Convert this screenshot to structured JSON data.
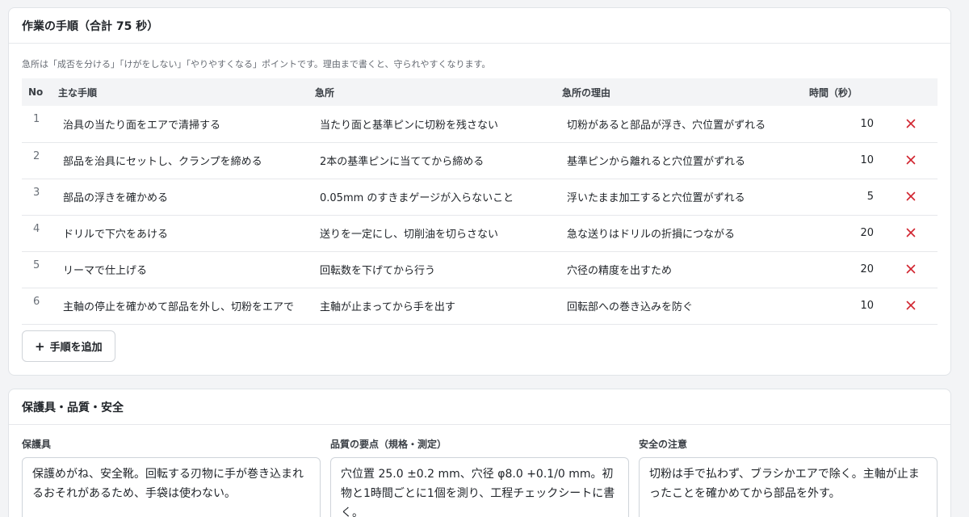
{
  "steps_section": {
    "title": "作業の手順（合計 75 秒）",
    "note": "急所は「成否を分ける」「けがをしない」「やりやすくなる」ポイントです。理由まで書くと、守られやすくなります。",
    "columns": {
      "no": "No",
      "step": "主な手順",
      "key_point": "急所",
      "reason": "急所の理由",
      "time": "時間（秒）"
    },
    "rows": [
      {
        "no": "1",
        "step": "治具の当たり面をエアで清掃する",
        "key_point": "当たり面と基準ピンに切粉を残さない",
        "reason": "切粉があると部品が浮き、穴位置がずれる",
        "time": "10"
      },
      {
        "no": "2",
        "step": "部品を治具にセットし、クランプを締める",
        "key_point": "2本の基準ピンに当ててから締める",
        "reason": "基準ピンから離れると穴位置がずれる",
        "time": "10"
      },
      {
        "no": "3",
        "step": "部品の浮きを確かめる",
        "key_point": "0.05mm のすきまゲージが入らないこと",
        "reason": "浮いたまま加工すると穴位置がずれる",
        "time": "5"
      },
      {
        "no": "4",
        "step": "ドリルで下穴をあける",
        "key_point": "送りを一定にし、切削油を切らさない",
        "reason": "急な送りはドリルの折損につながる",
        "time": "20"
      },
      {
        "no": "5",
        "step": "リーマで仕上げる",
        "key_point": "回転数を下げてから行う",
        "reason": "穴径の精度を出すため",
        "time": "20"
      },
      {
        "no": "6",
        "step": "主軸の停止を確かめて部品を外し、切粉をエアで",
        "key_point": "主軸が止まってから手を出す",
        "reason": "回転部への巻き込みを防ぐ",
        "time": "10"
      }
    ],
    "delete_icon": "close-icon",
    "add_button": {
      "icon": "+",
      "label": "手順を追加"
    }
  },
  "safety_section": {
    "title": "保護具・品質・安全",
    "fields": {
      "ppe": {
        "label": "保護具",
        "value": "保護めがね、安全靴。回転する刃物に手が巻き込まれるおそれがあるため、手袋は使わない。"
      },
      "quality": {
        "label": "品質の要点（規格・測定）",
        "value": "穴位置 25.0 ±0.2 mm、穴径 φ8.0 +0.1/0 mm。初物と1時間ごとに1個を測り、工程チェックシートに書く。"
      },
      "safety": {
        "label": "安全の注意",
        "value": "切粉は手で払わず、ブラシかエアで除く。主軸が止まったことを確かめてから部品を外す。"
      }
    }
  },
  "colors": {
    "accent_delete": "#d1242f",
    "header_bg": "#f3f4f6",
    "border": "#e1e4e8"
  }
}
